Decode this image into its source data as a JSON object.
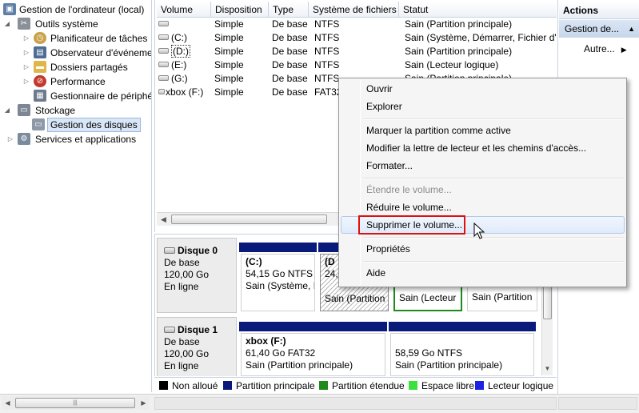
{
  "tree": {
    "root": "Gestion de l'ordinateur (local)",
    "outils": "Outils système",
    "planif": "Planificateur de tâches",
    "observ": "Observateur d'événeme",
    "dossiers": "Dossiers partagés",
    "perf": "Performance",
    "gest_periph": "Gestionnaire de périphé",
    "stockage": "Stockage",
    "gest_disques": "Gestion des disques",
    "services": "Services et applications"
  },
  "volumes": {
    "columns": [
      "Volume",
      "Disposition",
      "Type",
      "Système de fichiers",
      "Statut"
    ],
    "rows": [
      {
        "volume": "",
        "disposition": "Simple",
        "type": "De base",
        "fs": "NTFS",
        "status": "Sain (Partition principale)"
      },
      {
        "volume": "(C:)",
        "disposition": "Simple",
        "type": "De base",
        "fs": "NTFS",
        "status": "Sain (Système, Démarrer, Fichier d'é"
      },
      {
        "volume": "(D:)",
        "disposition": "Simple",
        "type": "De base",
        "fs": "NTFS",
        "status": "Sain (Partition principale)"
      },
      {
        "volume": "(E:)",
        "disposition": "Simple",
        "type": "De base",
        "fs": "NTFS",
        "status": "Sain (Lecteur logique)"
      },
      {
        "volume": "(G:)",
        "disposition": "Simple",
        "type": "De base",
        "fs": "NTFS",
        "status": "Sain (Partition principale)"
      },
      {
        "volume": "xbox (F:)",
        "disposition": "Simple",
        "type": "De base",
        "fs": "FAT32",
        "status": ""
      }
    ]
  },
  "disks": {
    "disk0": {
      "name": "Disque 0",
      "kind": "De base",
      "size": "120,00 Go",
      "state": "En ligne",
      "p1": {
        "name": "(C:)",
        "size": "54,15 Go NTFS",
        "status": "Sain (Système, D"
      },
      "p2": {
        "name": "(D",
        "size": "24,4",
        "status": "Sain (Partition"
      },
      "p3": {
        "status": "Sain (Lecteur"
      },
      "p4": {
        "status": "Sain (Partition"
      }
    },
    "disk1": {
      "name": "Disque 1",
      "kind": "De base",
      "size": "120,00 Go",
      "state": "En ligne",
      "p1": {
        "name": "xbox  (F:)",
        "size": "61,40 Go FAT32",
        "status": "Sain (Partition principale)"
      },
      "p2": {
        "size": "58,59 Go NTFS",
        "status": "Sain (Partition principale)"
      }
    }
  },
  "legend": [
    {
      "label": "Non alloué",
      "color": "#000000"
    },
    {
      "label": "Partition principale",
      "color": "#0a1a7a"
    },
    {
      "label": "Partition étendue",
      "color": "#1d8a1d"
    },
    {
      "label": "Espace libre",
      "color": "#3ce03c"
    },
    {
      "label": "Lecteur logique",
      "color": "#1a24e0"
    }
  ],
  "actions": {
    "title": "Actions",
    "section": "Gestion de...",
    "more": "Autre..."
  },
  "menu": {
    "open": "Ouvrir",
    "explore": "Explorer",
    "mark_active": "Marquer la partition comme active",
    "change_letter": "Modifier la lettre de lecteur et les chemins d'accès...",
    "format": "Formater...",
    "extend": "Étendre le volume...",
    "shrink": "Réduire le volume...",
    "delete": "Supprimer le volume...",
    "properties": "Propriétés",
    "help": "Aide"
  },
  "colors": {
    "primary_partition": "#0a1a7a",
    "extended_partition": "#1d8a1d",
    "highlight_box": "#e01010",
    "selection": "#d9e6f5"
  }
}
